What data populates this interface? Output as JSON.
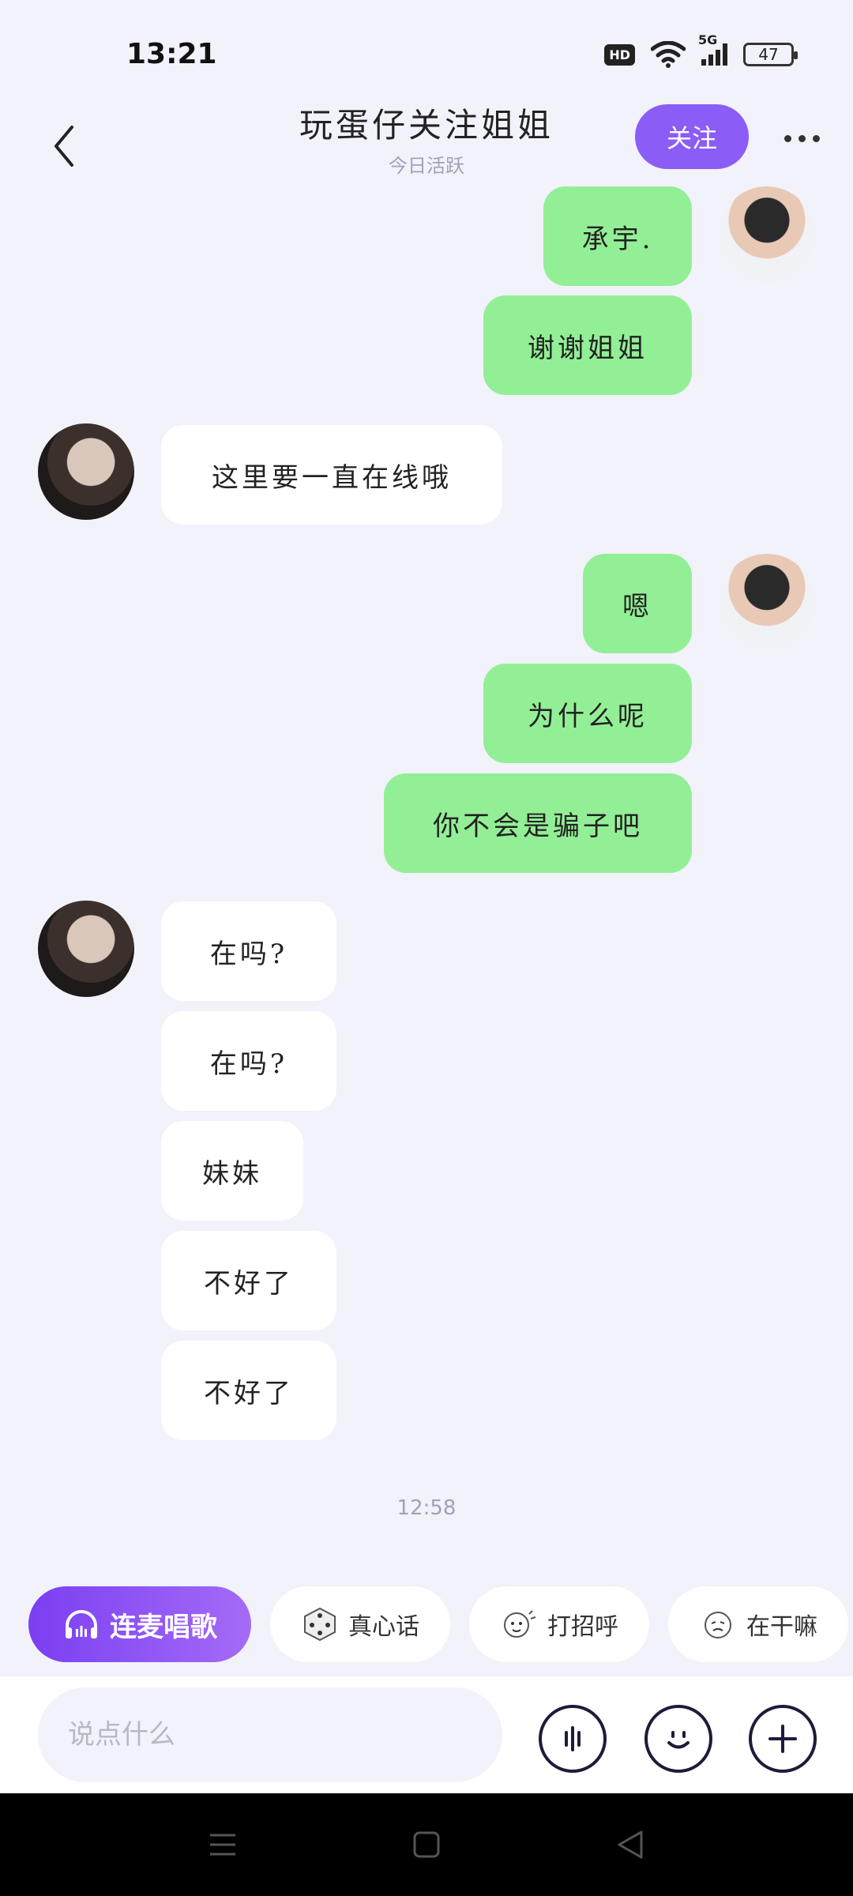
{
  "status": {
    "time": "13:21",
    "hd": "HD",
    "network": "5G",
    "battery": "47"
  },
  "header": {
    "title": "玩蛋仔关注姐姐",
    "subtitle": "今日活跃",
    "follow_label": "关注"
  },
  "messages": {
    "m1": "承宇.",
    "m2": "谢谢姐姐",
    "m3": "这里要一直在线哦",
    "m4": "嗯",
    "m5": "为什么呢",
    "m6": "你不会是骗子吧",
    "m7": "在吗?",
    "m8": "在吗?",
    "m9": "妹妹",
    "m10": "不好了",
    "m11": "不好了"
  },
  "timestamp": "12:58",
  "chips": [
    {
      "label": "连麦唱歌",
      "icon": "headphones-icon"
    },
    {
      "label": "真心话",
      "icon": "dice-icon"
    },
    {
      "label": "打招呼",
      "icon": "wave-icon"
    },
    {
      "label": "在干嘛",
      "icon": "face-icon"
    }
  ],
  "input": {
    "placeholder": "说点什么"
  },
  "colors": {
    "accent": "#8b5cf6",
    "my_bubble": "#93ef96",
    "their_bubble": "#ffffff",
    "background": "#f2f2fb"
  }
}
